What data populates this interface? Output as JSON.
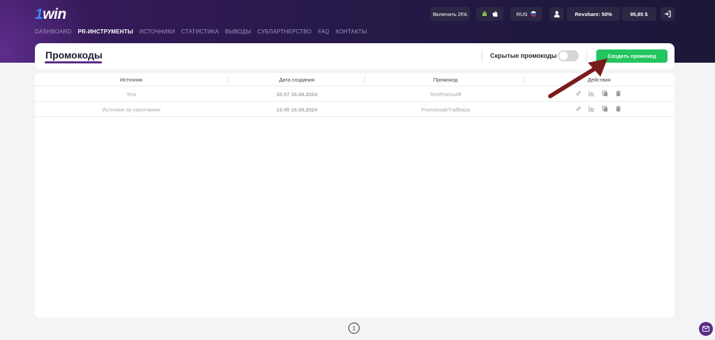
{
  "brand": {
    "logo_one": "1",
    "logo_win": "win"
  },
  "nav": [
    {
      "label": "DASHBOARD",
      "active": false
    },
    {
      "label": "PR-ИНСТРУМЕНТЫ",
      "active": true
    },
    {
      "label": "ИСТОЧНИКИ",
      "active": false
    },
    {
      "label": "СТАТИСТИКА",
      "active": false
    },
    {
      "label": "ВЫВОДЫ",
      "active": false
    },
    {
      "label": "СУБПАРТНЕРСТВО",
      "active": false
    },
    {
      "label": "FAQ",
      "active": false
    },
    {
      "label": "КОНТАКТЫ",
      "active": false
    }
  ],
  "topbar": {
    "twofa_label": "Включить 2FA",
    "lang_label": "RUS",
    "revshare_label": "Revshare: 50%",
    "balance_label": "95,85 $",
    "icons": [
      "android-icon",
      "apple-icon",
      "russia-flag-icon",
      "user-icon",
      "logout-icon"
    ]
  },
  "header": {
    "title": "Промокоды",
    "hidden_label": "Скрытые промокоды",
    "hidden_toggle_on": false,
    "create_button": "Создать промокод"
  },
  "table": {
    "columns": [
      "Источник",
      "Дата создания",
      "Промокод",
      "Действия"
    ],
    "rows": [
      {
        "source": "Test",
        "date": "16:57 16.08.2024",
        "promo": "TestPromoAff"
      },
      {
        "source": "Источник по умолчанию",
        "date": "13:45 16.08.2024",
        "promo": "PromocodeTraffbaza"
      }
    ],
    "action_icons": [
      "link-icon",
      "chart-icon",
      "copy-icon",
      "trash-icon"
    ]
  },
  "pagination": {
    "current_page": "1"
  },
  "colors": {
    "accent_green": "#22c55e",
    "brand_purple": "#5b2d86",
    "annotation_arrow": "#7a1b1b"
  }
}
